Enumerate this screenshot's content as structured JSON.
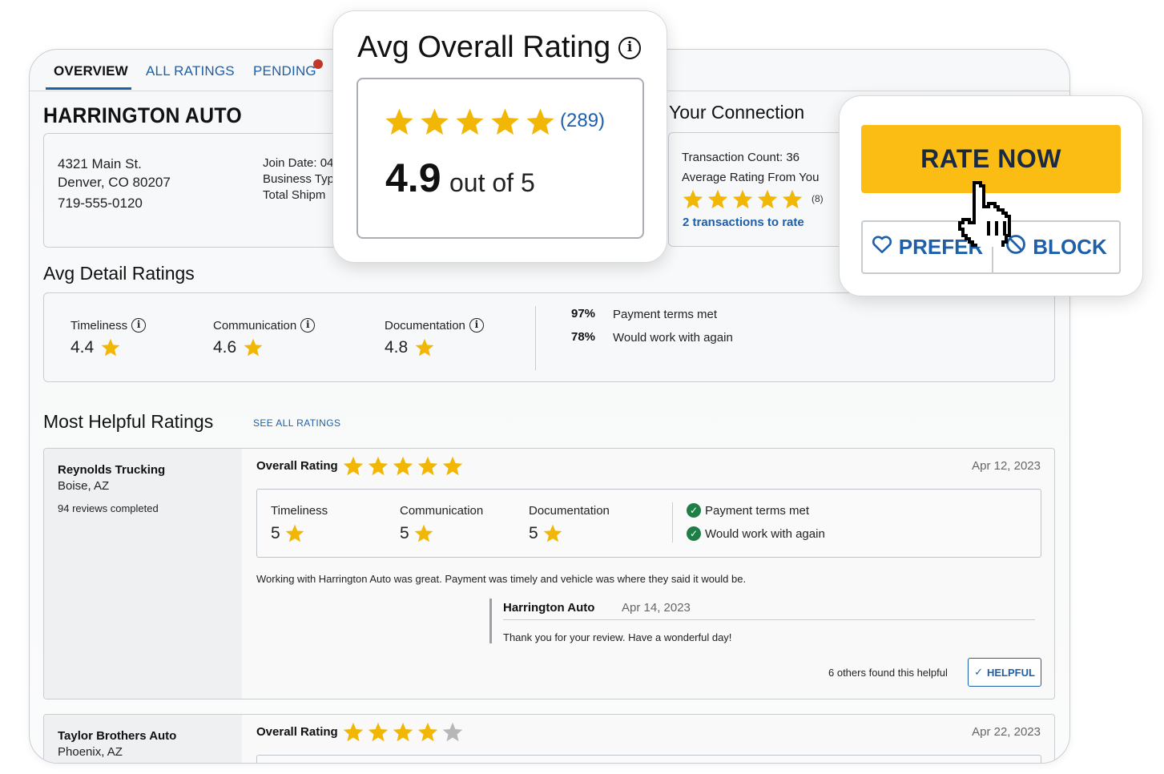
{
  "tabs": [
    {
      "label": "OVERVIEW",
      "active": true
    },
    {
      "label": "ALL RATINGS",
      "active": false
    },
    {
      "label": "PENDING",
      "active": false
    }
  ],
  "company": {
    "name": "HARRINGTON AUTO",
    "address_line1": "4321 Main St.",
    "address_line2": "Denver, CO 80207",
    "phone": "719-555-0120",
    "join_date_label": "Join Date: 04",
    "business_type_label": "Business Typ",
    "total_shipments_label": "Total Shipm"
  },
  "overall": {
    "title": "Avg Overall Rating",
    "info_icon": "info-icon",
    "stars": 5,
    "count": "(289)",
    "score": "4.9",
    "out_of": "out of 5"
  },
  "connection": {
    "title": "Your Connection",
    "transaction_count": "Transaction Count: 36",
    "average_label": "Average Rating From You",
    "stars": 5,
    "count": "(8)",
    "to_rate_link": "2 transactions to rate"
  },
  "actions": {
    "rate_now": "RATE NOW",
    "prefer": "PREFER",
    "block": "BLOCK"
  },
  "detail": {
    "title": "Avg Detail Ratings",
    "items": [
      {
        "label": "Timeliness",
        "value": "4.4"
      },
      {
        "label": "Communication",
        "value": "4.6"
      },
      {
        "label": "Documentation",
        "value": "4.8"
      }
    ],
    "stats": [
      {
        "pct": "97%",
        "label": "Payment terms met"
      },
      {
        "pct": "78%",
        "label": "Would work with again"
      }
    ]
  },
  "helpful": {
    "title": "Most Helpful Ratings",
    "see_all": "SEE ALL RATINGS"
  },
  "reviews": [
    {
      "reviewer": "Reynolds Trucking",
      "location": "Boise, AZ",
      "reviews_completed": "94 reviews completed",
      "overall_label": "Overall Rating",
      "stars": 5,
      "date": "Apr 12, 2023",
      "details": [
        {
          "label": "Timeliness",
          "value": "5"
        },
        {
          "label": "Communication",
          "value": "5"
        },
        {
          "label": "Documentation",
          "value": "5"
        }
      ],
      "checks": [
        "Payment terms met",
        "Would work with again"
      ],
      "comment": "Working with Harrington Auto was great. Payment was timely and vehicle was where they said it would be.",
      "reply": {
        "author": "Harrington Auto",
        "date": "Apr 14, 2023",
        "text": "Thank you for your review. Have a wonderful day!"
      },
      "helpful_count": "6 others found this helpful",
      "helpful_button": "HELPFUL"
    },
    {
      "reviewer": "Taylor Brothers Auto",
      "location": "Phoenix, AZ",
      "overall_label": "Overall Rating",
      "stars": 4,
      "date": "Apr 22, 2023"
    }
  ],
  "colors": {
    "accent_blue": "#1d5fa8",
    "star_gold": "#f2b705",
    "star_empty": "#b7b7b7",
    "rate_button": "#fbbd14",
    "check_green": "#1e7e46",
    "badge_red": "#c0392b"
  }
}
